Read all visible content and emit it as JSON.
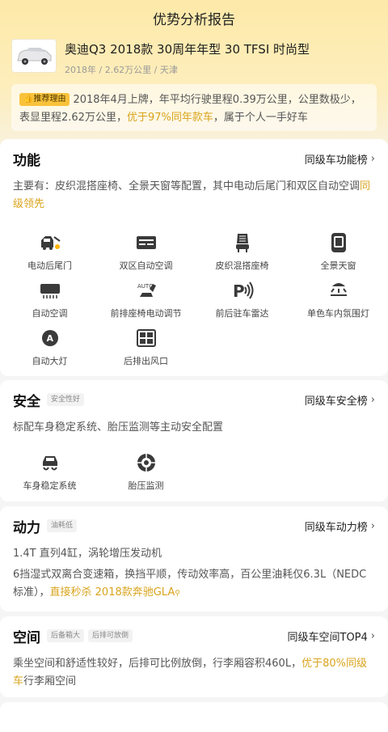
{
  "page": {
    "title": "优势分析报告"
  },
  "car": {
    "name": "奥迪Q3 2018款 30周年年型 30 TFSI 时尚型",
    "meta": "2018年 / 2.62万公里 / 天津"
  },
  "recommend": {
    "tag": "推荐理由",
    "text_a": "2018年4月上牌，年平均行驶里程0.39万公里，公里数极少，表显里程2.62万公里，",
    "highlight": "优于97%同年款车",
    "text_b": "，属于个人一手好车"
  },
  "features_card": {
    "title": "功能",
    "link": "同级车功能榜",
    "desc": "主要有：皮织混搭座椅、全景天窗等配置，其中电动后尾门和双区自动空调",
    "desc_hl": "同级领先",
    "items": [
      {
        "label": "电动后尾门",
        "icon": "tailgate-icon"
      },
      {
        "label": "双区自动空调",
        "icon": "dual-ac-icon"
      },
      {
        "label": "皮织混搭座椅",
        "icon": "seat-icon"
      },
      {
        "label": "全景天窗",
        "icon": "sunroof-icon"
      },
      {
        "label": "自动空调",
        "icon": "auto-ac-icon"
      },
      {
        "label": "前排座椅电动调节",
        "icon": "seat-adjust-icon"
      },
      {
        "label": "前后驻车雷达",
        "icon": "parking-radar-icon"
      },
      {
        "label": "单色车内氛围灯",
        "icon": "ambient-light-icon"
      },
      {
        "label": "自动大灯",
        "icon": "auto-headlight-icon"
      },
      {
        "label": "后排出风口",
        "icon": "rear-vent-icon"
      }
    ]
  },
  "safety_card": {
    "title": "安全",
    "badge": "安全性好",
    "link": "同级车安全榜",
    "desc": "标配车身稳定系统、胎压监测等主动安全配置",
    "items": [
      {
        "label": "车身稳定系统",
        "icon": "stability-icon"
      },
      {
        "label": "胎压监测",
        "icon": "tire-pressure-icon"
      }
    ]
  },
  "power_card": {
    "title": "动力",
    "badge": "油耗低",
    "link": "同级车动力榜",
    "line1": "1.4T 直列4缸，涡轮增压发动机",
    "line2": "6挡湿式双离合变速箱，换挡平顺，传动效率高，百公里油耗仅6.3L（NEDC标准），",
    "line2_hl": "直接秒杀 2018款奔驰GLA"
  },
  "space_card": {
    "title": "空间",
    "badge1": "后备箱大",
    "badge2": "后排可放倒",
    "link": "同级车空间TOP4",
    "desc": "乘坐空间和舒适性较好，后排可比例放倒，行李厢容积460L，",
    "desc_hl": "优于80%同级车",
    "desc_tail": "行李厢空间"
  },
  "colors": {
    "accent": "#d9a41d",
    "tag_bg": "#f9c23b"
  }
}
